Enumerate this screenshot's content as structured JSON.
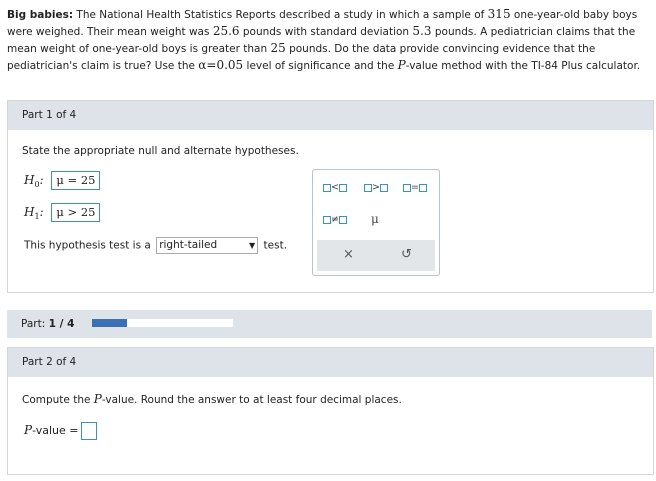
{
  "intro": {
    "title": "Big babies:",
    "s1": " The National Health Statistics Reports described a study in which a sample of ",
    "n": "315",
    "s2": " one-year-old baby boys were weighed. Their mean weight was ",
    "mean": "25.6",
    "s3": " pounds with standard deviation ",
    "sd": "5.3",
    "s4": " pounds. A pediatrician claims that the mean weight of one-year-old boys is greater than ",
    "claim": "25",
    "s5": " pounds. Do the data provide convincing evidence that the pediatrician's claim is true? Use the ",
    "alpha": "α=0.05",
    "s6": " level of significance and the ",
    "p": "P",
    "s7": "-value method with the TI-84 Plus calculator."
  },
  "part1": {
    "header": "Part 1 of 4",
    "instruction": "State the appropriate null and alternate hypotheses.",
    "h0": {
      "label": "H",
      "sub": "0",
      "value": "μ = 25"
    },
    "h1": {
      "label": "H",
      "sub": "1",
      "value": "μ > 25"
    },
    "test_prefix": "This hypothesis test is a",
    "test_value": "right-tailed",
    "test_suffix": "test.",
    "palette": {
      "lt": "<",
      "gt": ">",
      "eq": "=",
      "ne": "≠",
      "mu": "μ",
      "clear": "×",
      "undo": "↺"
    }
  },
  "progress": {
    "label": "Part:",
    "value": "1 / 4",
    "fraction": 0.25
  },
  "part2": {
    "header": "Part 2 of 4",
    "instr_a": "Compute the ",
    "instr_p": "P",
    "instr_b": "-value. Round the answer to at least four decimal places.",
    "pvalue_label_p": "P",
    "pvalue_label_rest": "-value ="
  }
}
